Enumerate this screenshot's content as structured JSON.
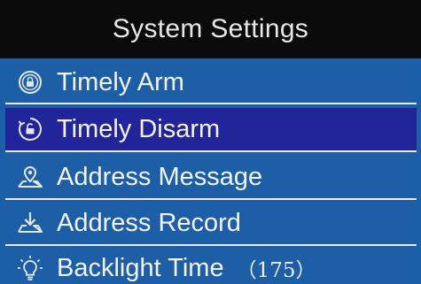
{
  "header": {
    "title": "System Settings"
  },
  "menu": {
    "items": [
      {
        "label": "Timely Arm",
        "icon": "clock-lock-icon",
        "selected": false
      },
      {
        "label": "Timely Disarm",
        "icon": "clock-unlock-icon",
        "selected": true
      },
      {
        "label": "Address Message",
        "icon": "address-pin-icon",
        "selected": false
      },
      {
        "label": "Address Record",
        "icon": "download-record-icon",
        "selected": false
      },
      {
        "label": "Backlight Time",
        "value": "（175）",
        "icon": "lightbulb-icon",
        "selected": false
      }
    ]
  },
  "colors": {
    "title_bar": "#0a0a0a",
    "menu_background": "#1d5fa7",
    "selected_background": "#22259a",
    "text": "#f2f4f8"
  }
}
